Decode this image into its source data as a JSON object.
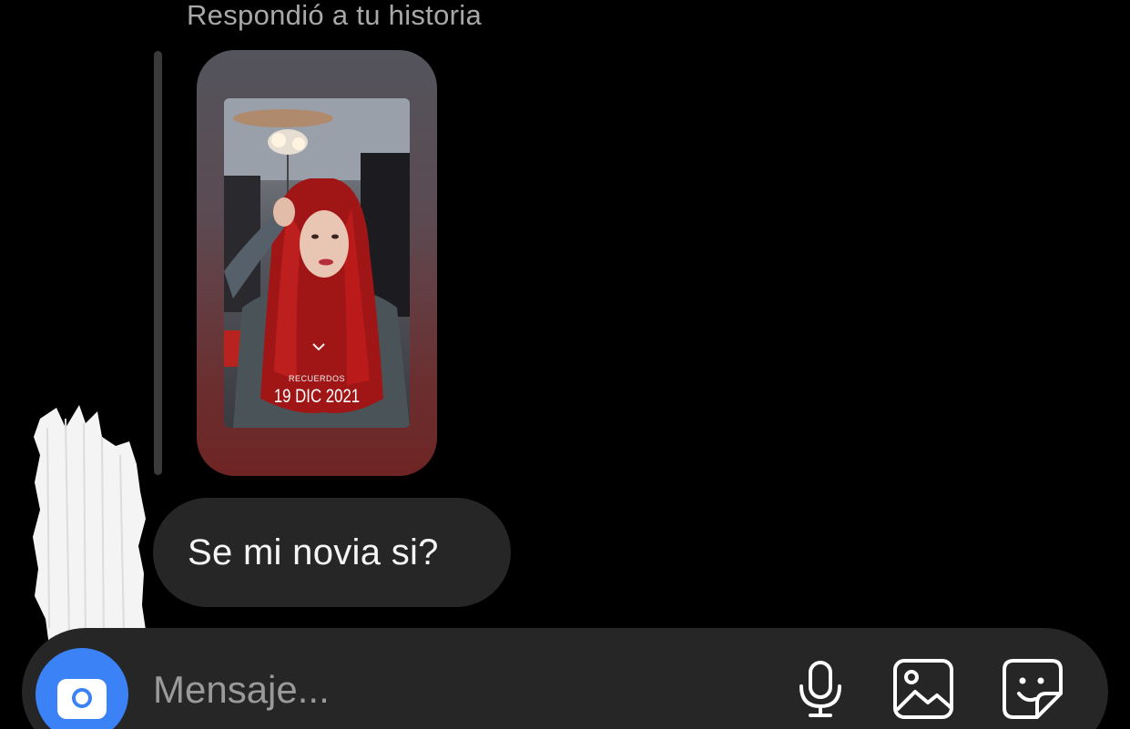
{
  "thread": {
    "reply_context": "Respondió a tu historia",
    "story": {
      "overlay_small": "RECUERDOS",
      "overlay_date": "19 DIC 2021"
    },
    "messages": [
      {
        "text": "Se mi novia si?"
      }
    ]
  },
  "composer": {
    "placeholder": "Mensaje...",
    "value": ""
  },
  "colors": {
    "background": "#000000",
    "bubble": "#262626",
    "accent_camera": "#3b82f6"
  },
  "icons": {
    "camera": "camera-icon",
    "mic": "microphone-icon",
    "gallery": "image-icon",
    "sticker": "sticker-icon"
  }
}
